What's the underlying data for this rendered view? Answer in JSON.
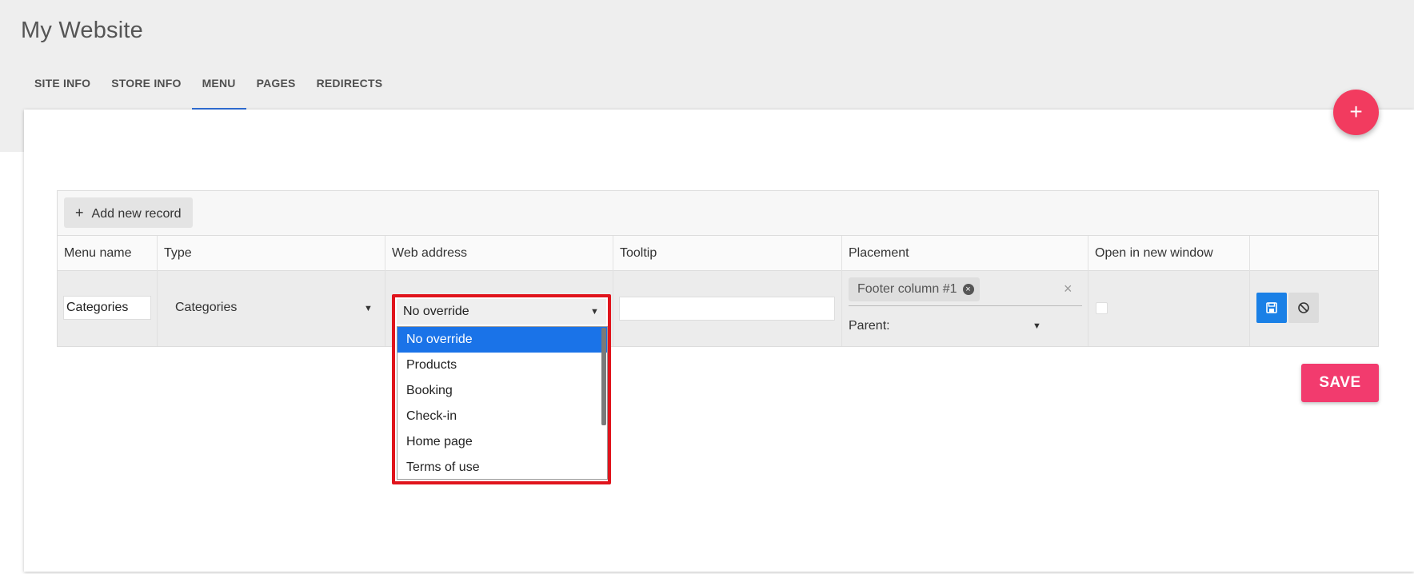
{
  "app": {
    "title": "My Website"
  },
  "tabs": [
    {
      "label": "SITE INFO"
    },
    {
      "label": "STORE INFO"
    },
    {
      "label": "MENU"
    },
    {
      "label": "PAGES"
    },
    {
      "label": "REDIRECTS"
    }
  ],
  "active_tab": "MENU",
  "fab": {
    "label": "+"
  },
  "toolbar": {
    "add_label": "Add new record",
    "add_icon": "plus-icon"
  },
  "columns": [
    {
      "label": "Menu name"
    },
    {
      "label": "Type"
    },
    {
      "label": "Web address"
    },
    {
      "label": "Tooltip"
    },
    {
      "label": "Placement"
    },
    {
      "label": "Open in new window"
    },
    {
      "label": ""
    }
  ],
  "row": {
    "menu_name": "Categories",
    "type": "Categories",
    "web_address": "No override",
    "tooltip": "",
    "placement_chip": "Footer column #1",
    "parent_label": "Parent:",
    "open_new_window": false
  },
  "dropdown": {
    "options": [
      "No override",
      "Products",
      "Booking",
      "Check-in",
      "Home page",
      "Terms of use"
    ],
    "selected": "No override"
  },
  "actions": {
    "save_label": "SAVE"
  },
  "colors": {
    "accent": "#f23b6e",
    "tab_indicator": "#2f6dd6",
    "highlight": "#e0141c",
    "row_save": "#1a80e6"
  }
}
